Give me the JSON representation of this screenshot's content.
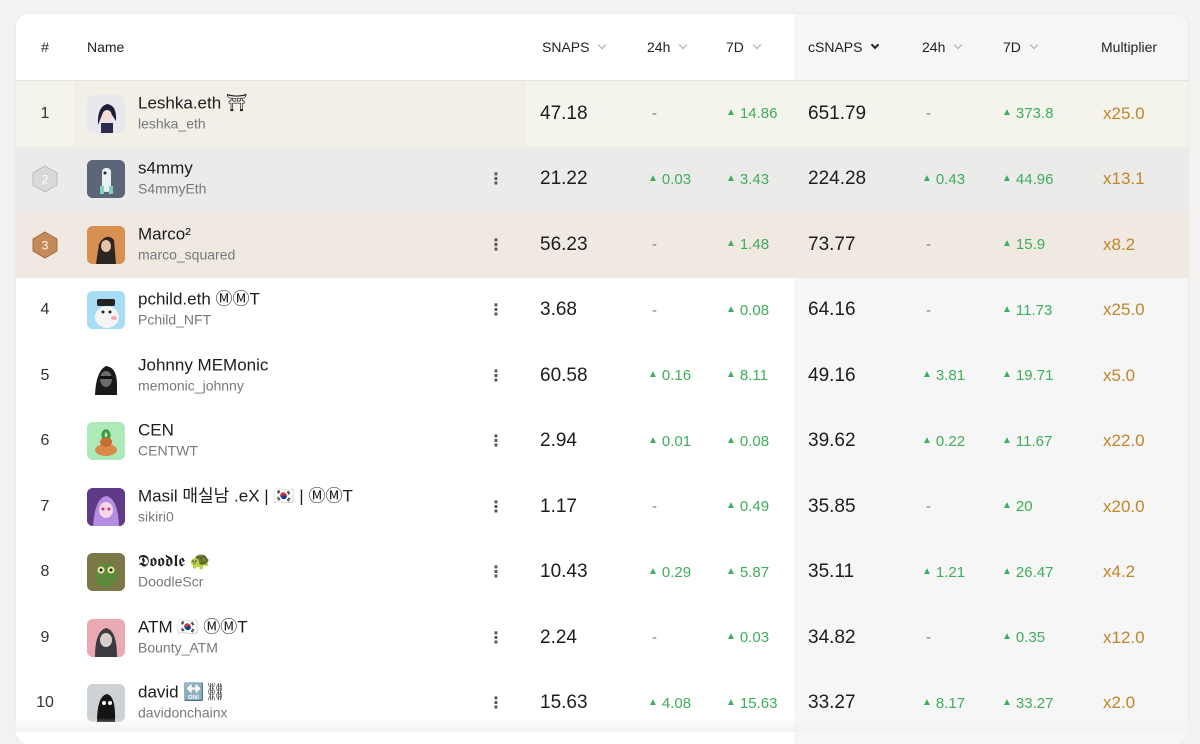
{
  "header": {
    "rank": "#",
    "name": "Name",
    "snaps": "SNAPS",
    "snaps_24h": "24h",
    "snaps_7d": "7D",
    "csnaps": "cSNAPS",
    "csnaps_24h": "24h",
    "csnaps_7d": "7D",
    "multiplier": "Multiplier"
  },
  "colors": {
    "up": "#3fae5b",
    "multiplier": "#c2852a",
    "highlight_rank1": "#f4f3ec",
    "highlight_rank2": "#ebebea",
    "highlight_rank3": "#efe9e2"
  },
  "rows": [
    {
      "rank": "1",
      "name": "Leshka.eth ⛩",
      "handle": "leshka_eth",
      "snaps": "47.18",
      "s24": "-",
      "s7": "14.86",
      "csnaps": "651.79",
      "c24": "-",
      "c7": "373.8",
      "mult": "x25.0"
    },
    {
      "rank": "2",
      "name": "s4mmy",
      "handle": "S4mmyEth",
      "snaps": "21.22",
      "s24": "0.03",
      "s7": "3.43",
      "csnaps": "224.28",
      "c24": "0.43",
      "c7": "44.96",
      "mult": "x13.1"
    },
    {
      "rank": "3",
      "name": "Marco²",
      "handle": "marco_squared",
      "snaps": "56.23",
      "s24": "-",
      "s7": "1.48",
      "csnaps": "73.77",
      "c24": "-",
      "c7": "15.9",
      "mult": "x8.2"
    },
    {
      "rank": "4",
      "name": "pchild.eth ⓂⓂT",
      "handle": "Pchild_NFT",
      "snaps": "3.68",
      "s24": "-",
      "s7": "0.08",
      "csnaps": "64.16",
      "c24": "-",
      "c7": "11.73",
      "mult": "x25.0"
    },
    {
      "rank": "5",
      "name": "Johnny MEMonic",
      "handle": "memonic_johnny",
      "snaps": "60.58",
      "s24": "0.16",
      "s7": "8.11",
      "csnaps": "49.16",
      "c24": "3.81",
      "c7": "19.71",
      "mult": "x5.0"
    },
    {
      "rank": "6",
      "name": "CEN",
      "handle": "CENTWT",
      "snaps": "2.94",
      "s24": "0.01",
      "s7": "0.08",
      "csnaps": "39.62",
      "c24": "0.22",
      "c7": "11.67",
      "mult": "x22.0"
    },
    {
      "rank": "7",
      "name": "Masil 매실남 .eX | 🇰🇷 | ⓂⓂT",
      "handle": "sikiri0",
      "snaps": "1.17",
      "s24": "-",
      "s7": "0.49",
      "csnaps": "35.85",
      "c24": "-",
      "c7": "20",
      "mult": "x20.0"
    },
    {
      "rank": "8",
      "name": "𝕯𝖔𝖔𝖉𝖑𝖊 🐢",
      "handle": "DoodleScr",
      "snaps": "10.43",
      "s24": "0.29",
      "s7": "5.87",
      "csnaps": "35.11",
      "c24": "1.21",
      "c7": "26.47",
      "mult": "x4.2"
    },
    {
      "rank": "9",
      "name": "ATM 🇰🇷 ⓂⓂT",
      "handle": "Bounty_ATM",
      "snaps": "2.24",
      "s24": "-",
      "s7": "0.03",
      "csnaps": "34.82",
      "c24": "-",
      "c7": "0.35",
      "mult": "x12.0"
    },
    {
      "rank": "10",
      "name": "david 🔛⛓",
      "handle": "davidonchainx",
      "snaps": "15.63",
      "s24": "4.08",
      "s7": "15.63",
      "csnaps": "33.27",
      "c24": "8.17",
      "c7": "33.27",
      "mult": "x2.0"
    }
  ]
}
